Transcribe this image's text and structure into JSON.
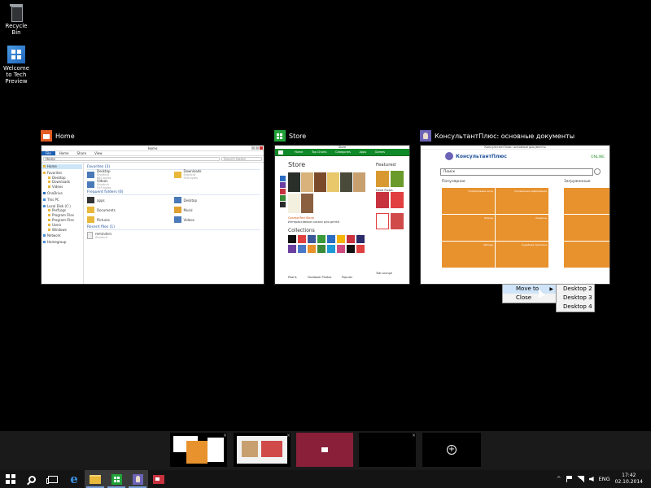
{
  "desktop": {
    "icons": [
      {
        "label": "Recycle Bin",
        "icon": "recycle-bin-icon"
      },
      {
        "label": "Welcome to Tech Preview",
        "icon": "windows-logo-icon"
      }
    ]
  },
  "windows": [
    {
      "title": "Home",
      "icon": "file-explorer-icon",
      "explorer": {
        "window_title": "Home",
        "ribbon_tabs": [
          "File",
          "Home",
          "Share",
          "View"
        ],
        "address": "Home",
        "search_placeholder": "Search Home",
        "nav": [
          "Home",
          "Favorites",
          "Desktop",
          "Downloads",
          "Videos",
          "OneDrive",
          "This PC",
          "Local Disk (C:)",
          "PerfLogs",
          "Program Files",
          "Program Files",
          "Users",
          "Windows",
          "Network",
          "Homegroup"
        ],
        "sections": {
          "favorites": "Favorites (3)",
          "frequent": "Frequent folders (6)",
          "recent": "Recent files (1)"
        },
        "favorites": [
          {
            "name": "Desktop",
            "sub1": "Shortcut",
            "sub2": "883 bytes"
          },
          {
            "name": "Downloads",
            "sub1": "Shortcut",
            "sub2": "920 bytes"
          },
          {
            "name": "Videos",
            "sub1": "Shortcut",
            "sub2": "919 bytes"
          }
        ],
        "frequent": [
          "apps",
          "Desktop",
          "Documents",
          "Music",
          "Pictures",
          "Videos"
        ],
        "recent": [
          {
            "name": "reminders",
            "sub1": "Shortcut",
            "sub2": "Shortcut"
          }
        ]
      }
    },
    {
      "title": "Store",
      "icon": "store-icon",
      "store": {
        "window_title": "Store",
        "tabs": [
          "Home",
          "Top Charts",
          "Categories",
          "Apps",
          "Games"
        ],
        "heading": "Store",
        "caption_title": "Сказки Red Stone",
        "caption_line": "Интерактивные сказки для детей",
        "collections": "Collections",
        "featured": "Featured",
        "featured_items": [
          "Dead Rivals",
          "Tab Lounge"
        ],
        "tile_labels": [
          "Pearls",
          "Facebook Photos",
          "Popular"
        ]
      }
    },
    {
      "title": "КонсультантПлюс: основные документы",
      "icon": "konsultant-icon",
      "kons": {
        "window_title": "КонсультантПлюс: основные документы",
        "brand": "КонсультантПлюс",
        "online": "ONLINE",
        "search": "Поиск",
        "popular": "Популярное",
        "loaded": "Загруженные",
        "tiles": [
          "Нормативные акты",
          "Справочная информация",
          "Формы",
          "Кодексы",
          "Обзоры",
          "Судебная практика"
        ]
      }
    }
  ],
  "context_menu": {
    "items": [
      {
        "label": "Move to",
        "has_submenu": true
      },
      {
        "label": "Close",
        "has_submenu": false
      }
    ],
    "submenu": [
      "Desktop 2",
      "Desktop 3",
      "Desktop 4"
    ]
  },
  "virtual_desktops": {
    "count": 4,
    "close_glyph": "×",
    "new_desktop": "+"
  },
  "taskbar": {
    "buttons": [
      {
        "name": "start-button",
        "icon": "windows-logo-icon"
      },
      {
        "name": "search-button",
        "icon": "search-icon"
      },
      {
        "name": "task-view-button",
        "icon": "task-view-icon"
      },
      {
        "name": "internet-explorer-button",
        "icon": "internet-explorer-icon"
      },
      {
        "name": "file-explorer-button",
        "icon": "folder-icon"
      },
      {
        "name": "store-button",
        "icon": "store-icon"
      },
      {
        "name": "konsultant-button",
        "icon": "konsultant-icon"
      },
      {
        "name": "red-app-button",
        "icon": "red-app-icon"
      }
    ],
    "tray": {
      "overflow": "^",
      "language": "ENG",
      "time": "17:42",
      "date": "02.10.2014"
    }
  },
  "colors": {
    "desktop_bg": "#000000",
    "explorer_accent": "#e35c25",
    "store_green": "#0f8a28",
    "kons_orange": "#e8922e",
    "taskbar": "#141414"
  }
}
